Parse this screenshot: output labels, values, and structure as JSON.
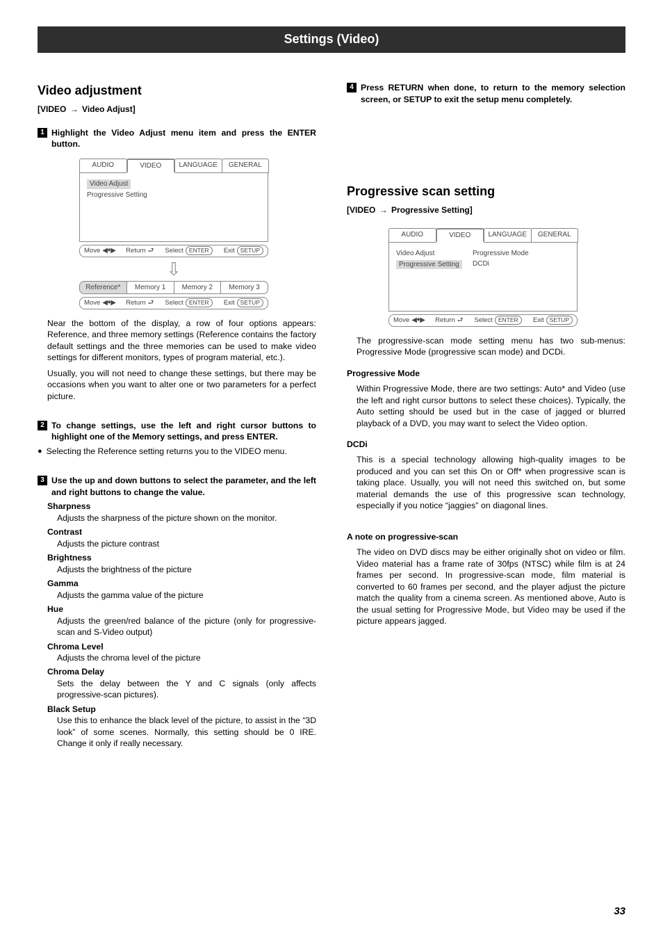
{
  "chapter_title": "Settings (Video)",
  "page_number": "33",
  "left": {
    "heading": "Video adjustment",
    "breadcrumb_a": "[VIDEO",
    "breadcrumb_b": "Video Adjust]",
    "step1": "Highlight the Video Adjust menu item and press the ENTER button.",
    "fig1": {
      "tabs": [
        "AUDIO",
        "VIDEO",
        "LANGUAGE",
        "GENERAL"
      ],
      "active_tab_index": 1,
      "items": [
        "Video Adjust",
        "Progressive Setting"
      ],
      "highlight_index": 0,
      "hints": {
        "move": "Move",
        "return": "Return",
        "select": "Select",
        "enter": "ENTER",
        "exit": "Exit",
        "setup": "SETUP"
      },
      "memrow": [
        "Reference*",
        "Memory 1",
        "Memory 2",
        "Memory 3"
      ]
    },
    "para1": "Near the bottom of the display, a row of four options appears: Reference, and three memory settings (Reference contains the factory default settings and the three memories can be used to make video settings for different monitors, types of program material, etc.).",
    "para2": "Usually, you will not need to change these settings, but there may be occasions when you want to alter one or two parameters for a perfect picture.",
    "step2": "To change settings, use the left and right cursor buttons to highlight one of the Memory settings, and press ENTER.",
    "bullet1": "Selecting the Reference setting returns you to the VIDEO menu.",
    "step3": "Use the up and down buttons to select the parameter, and the left and right buttons to change the value.",
    "params": [
      {
        "name": "Sharpness",
        "desc": "Adjusts the sharpness of the picture shown on the monitor."
      },
      {
        "name": "Contrast",
        "desc": "Adjusts the picture contrast"
      },
      {
        "name": "Brightness",
        "desc": "Adjusts the brightness of the picture"
      },
      {
        "name": "Gamma",
        "desc": "Adjusts the gamma value of the picture"
      },
      {
        "name": "Hue",
        "desc": "Adjusts the green/red balance of the picture (only for progressive-scan and S-Video output)"
      },
      {
        "name": "Chroma Level",
        "desc": "Adjusts the chroma level of the picture"
      },
      {
        "name": "Chroma Delay",
        "desc": "Sets the delay between the Y and C signals (only affects progressive-scan pictures)."
      },
      {
        "name": "Black Setup",
        "desc": "Use this to enhance the black level of the picture, to assist in the “3D look” of some scenes. Normally, this setting should be 0 IRE. Change it only if really necessary."
      }
    ]
  },
  "right": {
    "step4": "Press RETURN when done, to return to the memory selection screen, or SETUP to exit the setup menu completely.",
    "heading": "Progressive scan setting",
    "breadcrumb_a": "[VIDEO",
    "breadcrumb_b": "Progressive Setting]",
    "fig2": {
      "tabs": [
        "AUDIO",
        "VIDEO",
        "LANGUAGE",
        "GENERAL"
      ],
      "active_tab_index": 1,
      "items_left": [
        "Video Adjust",
        "Progressive Setting"
      ],
      "highlight_left_index": 1,
      "items_right": [
        "Progressive Mode",
        "DCDi"
      ],
      "hints": {
        "move": "Move",
        "return": "Return",
        "select": "Select",
        "enter": "ENTER",
        "exit": "Exit",
        "setup": "SETUP"
      }
    },
    "para_intro": "The progressive-scan mode setting menu has two sub-menus: Progressive Mode (progressive scan mode) and DCDi.",
    "pm_head": "Progressive Mode",
    "pm_body": "Within Progressive Mode, there are two settings: Auto* and Video (use the left and right cursor buttons to select these choices). Typically, the Auto setting should be used but in the case of jagged or blurred playback of a DVD, you may want to select the Video option.",
    "dcdi_head": "DCDi",
    "dcdi_body": "This is a special technology allowing high-quality images to be produced and you can set this On or Off* when progressive scan is taking place. Usually, you will not need this switched on, but some material demands the use of this progressive scan technology, especially if you notice “jaggies” on diagonal lines.",
    "note_head": "A note on progressive-scan",
    "note_body": "The video on DVD discs may be either originally shot on video or film. Video material has a frame rate of 30fps (NTSC) while film is at 24 frames per second. In progressive-scan mode, film material is converted to 60 frames per second, and the player adjust the picture match the quality from a cinema screen. As mentioned above, Auto is the usual setting for Progressive Mode, but Video may be used if the picture appears jagged."
  }
}
